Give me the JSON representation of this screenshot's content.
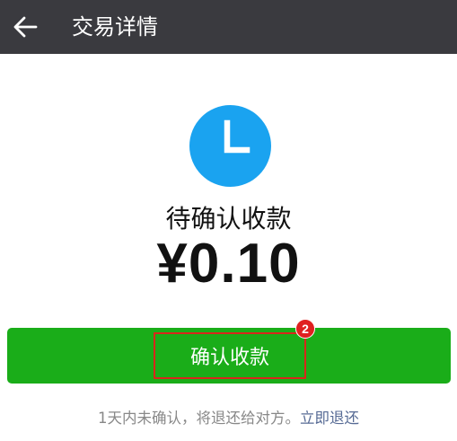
{
  "header": {
    "title": "交易详情",
    "back_icon": "arrow-left-icon"
  },
  "status": {
    "icon": "clock-icon",
    "icon_color": "#1aa3f0",
    "text": "待确认收款"
  },
  "amount": "¥0.10",
  "confirm_button": {
    "label": "确认收款",
    "color": "#1aad19",
    "highlight_color": "#d9261c",
    "badge": "2"
  },
  "footer": {
    "note": "1天内未确认，将退还给对方。",
    "refund_link": "立即退还"
  }
}
